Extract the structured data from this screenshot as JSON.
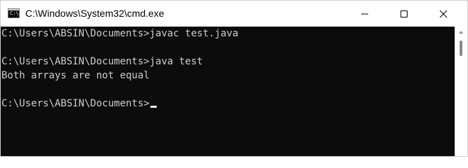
{
  "window": {
    "title": "C:\\Windows\\System32\\cmd.exe",
    "icon": "cmd-icon",
    "icon_glyph": "C:\\"
  },
  "caption_buttons": {
    "minimize": "minimize-icon",
    "maximize": "maximize-icon",
    "close": "close-icon"
  },
  "console": {
    "lines": [
      "C:\\Users\\ABSIN\\Documents>javac test.java",
      "C:\\Users\\ABSIN\\Documents>java test",
      "Both arrays are not equal",
      "C:\\Users\\ABSIN\\Documents>"
    ],
    "text_color": "#cccccc",
    "background": "#0c0c0c"
  },
  "scrollbar": {
    "up_arrow": "chevron-up-icon"
  }
}
